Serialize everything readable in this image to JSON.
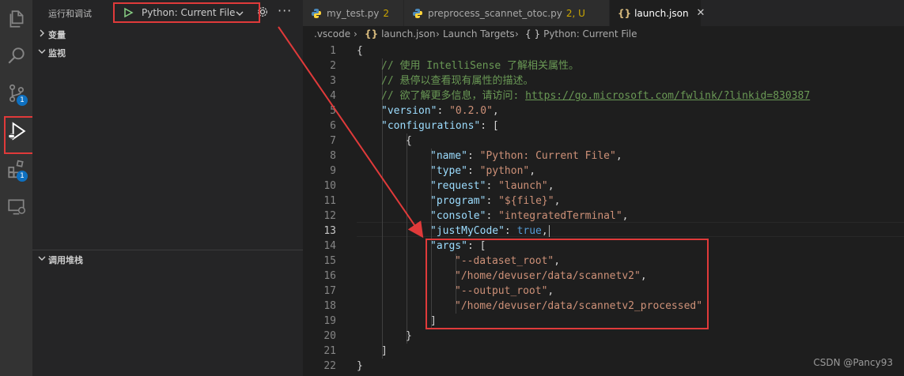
{
  "activity": {
    "scm_badge": "1",
    "ext_badge": "1"
  },
  "sidebar": {
    "title": "运行和调试",
    "config": "Python: Current File",
    "more": "···",
    "sections": {
      "variables": "变量",
      "watch": "监视",
      "callstack": "调用堆栈"
    }
  },
  "tabs": [
    {
      "label": "my_test.py",
      "flag": "2"
    },
    {
      "label": "preprocess_scannet_otoc.py",
      "flag": "2, U"
    },
    {
      "label": "launch.json",
      "close": "✕"
    }
  ],
  "breadcrumb": {
    "p1": ".vscode",
    "p2": "launch.json",
    "p3": "Launch Targets",
    "p4": "Python: Current File"
  },
  "code": {
    "line_numbers": [
      "1",
      "2",
      "3",
      "4",
      "5",
      "6",
      "7",
      "8",
      "9",
      "10",
      "11",
      "12",
      "13",
      "14",
      "15",
      "16",
      "17",
      "18",
      "19",
      "20",
      "21",
      "22"
    ],
    "l1": "{",
    "l2": "// 使用 IntelliSense 了解相关属性。",
    "l3": "// 悬停以查看现有属性的描述。",
    "l4_comment": "// 欲了解更多信息，请访问: ",
    "l4_link": "https://go.microsoft.com/fwlink/?linkid=830387",
    "l5_key": "\"version\"",
    "l5_val": "\"0.2.0\"",
    "l6_key": "\"configurations\"",
    "l6_rest": ": [",
    "l7": "{",
    "l8_key": "\"name\"",
    "l8_val": "\"Python: Current File\"",
    "l9_key": "\"type\"",
    "l9_val": "\"python\"",
    "l10_key": "\"request\"",
    "l10_val": "\"launch\"",
    "l11_key": "\"program\"",
    "l11_val": "\"${file}\"",
    "l12_key": "\"console\"",
    "l12_val": "\"integratedTerminal\"",
    "l13_key": "\"justMyCode\"",
    "l13_val": "true",
    "l14_key": "\"args\"",
    "l14_rest": ": [",
    "l15": "\"--dataset_root\"",
    "l16": "\"/home/devuser/data/scannetv2\"",
    "l17": "\"--output_root\"",
    "l18": "\"/home/devuser/data/scannetv2_processed\"",
    "l19": "]",
    "l20": "}",
    "l21": "]",
    "l22": "}"
  },
  "watermark": "CSDN @Pancy93",
  "colors": {
    "annotation": "#e03a3a",
    "badge": "#0e70c0"
  }
}
